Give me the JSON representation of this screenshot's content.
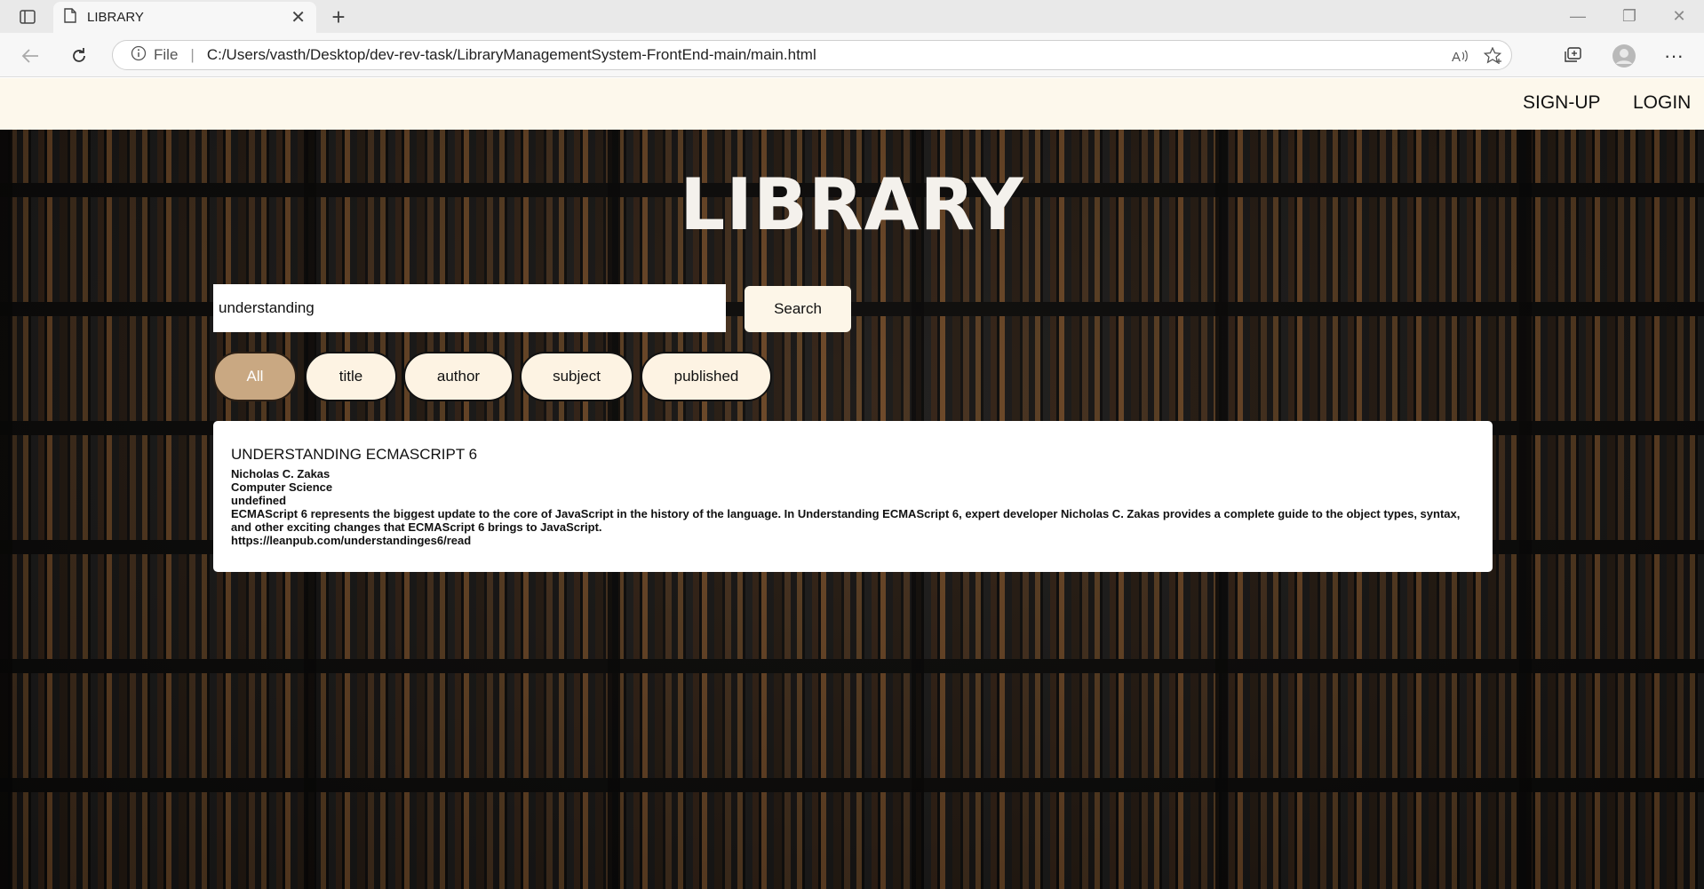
{
  "browser": {
    "tab_title": "LIBRARY",
    "address_scheme_label": "File",
    "url": "C:/Users/vasth/Desktop/dev-rev-task/LibraryManagementSystem-FrontEnd-main/main.html"
  },
  "nav": {
    "signup": "SIGN-UP",
    "login": "LOGIN"
  },
  "hero": {
    "title": "LIBRARY"
  },
  "search": {
    "value": "understanding",
    "button_label": "Search"
  },
  "filters": [
    {
      "label": "All",
      "active": true
    },
    {
      "label": "title",
      "active": false
    },
    {
      "label": "author",
      "active": false
    },
    {
      "label": "subject",
      "active": false
    },
    {
      "label": "published",
      "active": false
    }
  ],
  "result": {
    "title": "UNDERSTANDING ECMASCRIPT 6",
    "author": "Nicholas C. Zakas",
    "subject": "Computer Science",
    "published": "undefined",
    "description": "ECMAScript 6 represents the biggest update to the core of JavaScript in the history of the language. In Understanding ECMAScript 6, expert developer Nicholas C. Zakas provides a complete guide to the object types, syntax, and other exciting changes that ECMAScript 6 brings to JavaScript.",
    "link": "https://leanpub.com/understandinges6/read"
  },
  "colors": {
    "nav_bg": "#fdf8ec",
    "active_pill": "#c9a882",
    "pill_bg": "#fdf3e3"
  }
}
